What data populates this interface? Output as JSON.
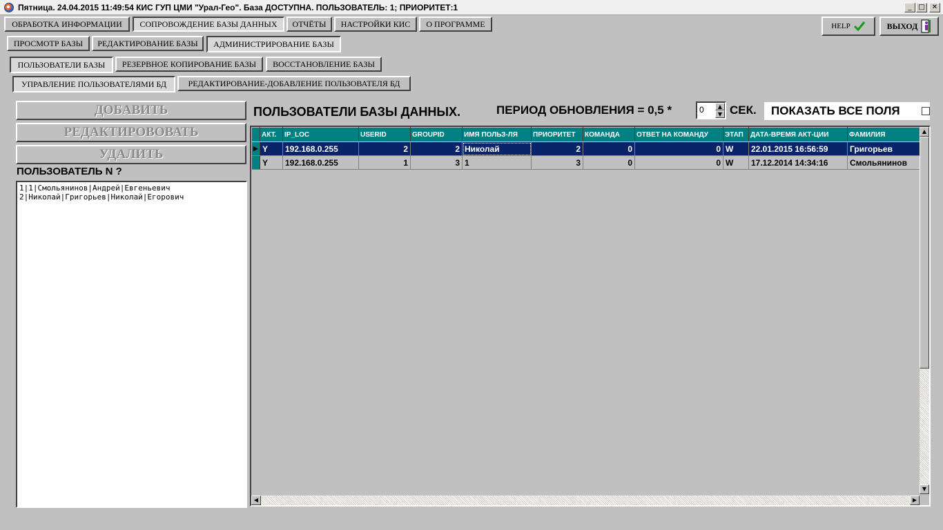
{
  "window": {
    "title": "Пятница. 24.04.2015 11:49:54 КИС ГУП ЦМИ \"Урал-Гео\". База ДОСТУПНА. ПОЛЬЗОВАТЕЛЬ: 1; ПРИОРИТЕТ:1",
    "minimize": "_",
    "maximize": "□",
    "close": "✕"
  },
  "menu_tabs": [
    {
      "label": "ОБРАБОТКА ИНФОРМАЦИИ"
    },
    {
      "label": "СОПРОВОЖДЕНИЕ БАЗЫ ДАННЫХ"
    },
    {
      "label": "ОТЧЁТЫ"
    },
    {
      "label": "НАСТРОЙКИ КИС"
    },
    {
      "label": "О ПРОГРАММЕ"
    }
  ],
  "help_button": {
    "label": "HELP",
    "icon": "checkmark-icon",
    "icon_color": "#1a9a1a"
  },
  "exit_button": {
    "label": "ВЫХОД",
    "icon": "exit-door-icon"
  },
  "sub_tabs_1": [
    {
      "label": "ПРОСМОТР БАЗЫ"
    },
    {
      "label": "РЕДАКТИРОВАНИЕ БАЗЫ"
    },
    {
      "label": "АДМИНИСТРИРОВАНИЕ БАЗЫ"
    }
  ],
  "sub_tabs_2": [
    {
      "label": "ПОЛЬЗОВАТЕЛИ БАЗЫ"
    },
    {
      "label": "РЕЗЕРВНОЕ КОПИРОВАНИЕ БАЗЫ"
    },
    {
      "label": "ВОССТАНОВЛЕНИЕ БАЗЫ"
    }
  ],
  "sub_tabs_3": [
    {
      "label": "УПРАВЛЕНИЕ ПОЛЬЗОВАТЕЛЯМИ БД"
    },
    {
      "label": "РЕДАКТИРОВАНИЕ-ДОБАВЛЕНИЕ  ПОЛЬЗОВАТЕЛЯ БД"
    }
  ],
  "actions": {
    "add": "ДОБАВИТЬ",
    "edit": "РЕДАКТИРОВОВАТЬ",
    "delete": "УДАЛИТЬ"
  },
  "user_label": "ПОЛЬЗОВАТЕЛЬ N ?",
  "user_list": [
    "1|1|Смольянинов|Андрей|Евгеньевич",
    "2|Николай|Григорьев|Николай|Егорович"
  ],
  "users_heading": "ПОЛЬЗОВАТЕЛИ БАЗЫ ДАННЫХ.",
  "refresh": {
    "label": "ПЕРИОД ОБНОВЛЕНИЯ = 0,5 *",
    "value": "0",
    "unit": "СЕК."
  },
  "show_all_fields": {
    "label": "ПОКАЗАТЬ ВСЕ ПОЛЯ",
    "checked": false
  },
  "grid": {
    "columns": [
      "АКТ.",
      "IP_LOC",
      "USERID",
      "GROUPID",
      "ИМЯ ПОЛЬЗ-ЛЯ",
      "ПРИОРИТЕТ",
      "КОМАНДА",
      "ОТВЕТ НА КОМАНДУ",
      "ЭТАП",
      "ДАТА-ВРЕМЯ АКТ-ЦИИ",
      "ФАМИЛИЯ"
    ],
    "rows": [
      [
        "Y",
        "192.168.0.255",
        "2",
        "2",
        "Николай",
        "2",
        "0",
        "0",
        "W",
        "22.01.2015 16:56:59",
        "Григорьев"
      ],
      [
        "Y",
        "192.168.0.255",
        "1",
        "3",
        "1",
        "3",
        "0",
        "0",
        "W",
        "17.12.2014 14:34:16",
        "Смольянинов"
      ]
    ],
    "selected_row": 0
  },
  "colors": {
    "header_bg": "#008080",
    "selection_bg": "#0a246a",
    "window_bg": "#c0c0c0"
  }
}
